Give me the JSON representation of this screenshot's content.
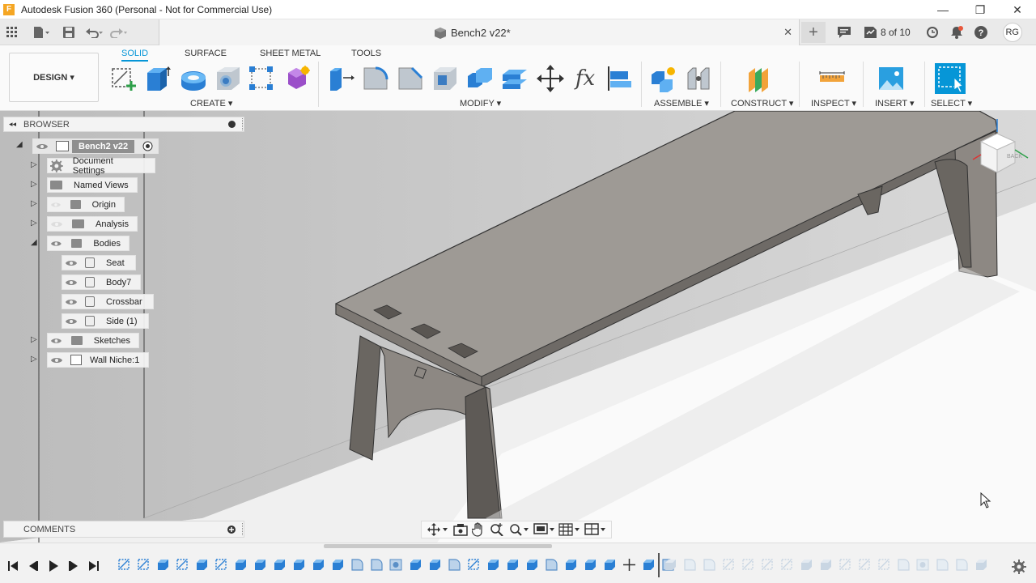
{
  "titlebar": {
    "app_icon": "F",
    "title": "Autodesk Fusion 360 (Personal - Not for Commercial Use)",
    "minimize": "—",
    "restore": "❐",
    "close": "✕"
  },
  "tabbar": {
    "doc_title": "Bench2 v22*",
    "close": "✕",
    "new_tab": "+",
    "job_status": "8 of 10",
    "user_initials": "RG"
  },
  "toolbar": {
    "design_label": "DESIGN ▾",
    "tabs": [
      "SOLID",
      "SURFACE",
      "SHEET METAL",
      "TOOLS"
    ],
    "active_tab": "SOLID",
    "groups": {
      "create": "CREATE ▾",
      "modify": "MODIFY ▾",
      "assemble": "ASSEMBLE ▾",
      "construct": "CONSTRUCT ▾",
      "inspect": "INSPECT ▾",
      "insert": "INSERT ▾",
      "select": "SELECT ▾"
    },
    "accent_color": "#0696d7"
  },
  "browser": {
    "title": "BROWSER",
    "collapse": "◂◂",
    "items": [
      {
        "label": "Bench2 v22",
        "type": "component"
      },
      {
        "label": "Document Settings",
        "type": "settings"
      },
      {
        "label": "Named Views",
        "type": "folder"
      },
      {
        "label": "Origin",
        "type": "folder"
      },
      {
        "label": "Analysis",
        "type": "folder"
      },
      {
        "label": "Bodies",
        "type": "folder"
      },
      {
        "label": "Seat",
        "type": "body"
      },
      {
        "label": "Body7",
        "type": "body"
      },
      {
        "label": "Crossbar",
        "type": "body"
      },
      {
        "label": "Side (1)",
        "type": "body"
      },
      {
        "label": "Sketches",
        "type": "folder"
      },
      {
        "label": "Wall Niche:1",
        "type": "component"
      }
    ]
  },
  "comments": {
    "title": "COMMENTS"
  },
  "viewcube": {
    "face": "BACK"
  },
  "timeline": {
    "controls": [
      "first",
      "previous",
      "play",
      "next",
      "last"
    ]
  }
}
